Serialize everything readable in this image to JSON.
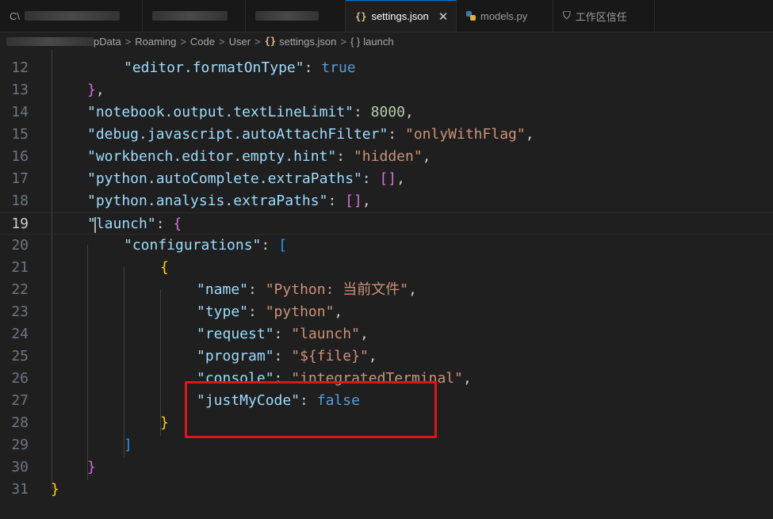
{
  "tabs": [
    {
      "label": "C\\",
      "blurred": true
    },
    {
      "label": "",
      "blurred": true
    },
    {
      "label": "",
      "blurred": true
    },
    {
      "label": "settings.json",
      "active": true,
      "icon": "curly-braces-icon"
    },
    {
      "label": "models.py",
      "icon": "python-icon"
    },
    {
      "label": "工作区信任",
      "icon": "shield-icon"
    }
  ],
  "close_glyph": "✕",
  "breadcrumb": {
    "separator": ">",
    "items": [
      "pData",
      "Roaming",
      "Code",
      "User",
      "settings.json",
      "launch"
    ],
    "json_icon": "{}",
    "object_icon": "{ }"
  },
  "editor": {
    "current_line": 19,
    "lines": [
      {
        "n": "12",
        "tokens": [
          [
            "k",
            "\"editor.formatOnType\""
          ],
          [
            "p",
            ": "
          ],
          [
            "b",
            "true"
          ]
        ]
      },
      {
        "n": "13",
        "tokens": [
          [
            "br2",
            "}"
          ],
          [
            "p",
            ","
          ]
        ]
      },
      {
        "n": "14",
        "tokens": [
          [
            "k",
            "\"notebook.output.textLineLimit\""
          ],
          [
            "p",
            ": "
          ],
          [
            "n",
            "8000"
          ],
          [
            "p",
            ","
          ]
        ]
      },
      {
        "n": "15",
        "tokens": [
          [
            "k",
            "\"debug.javascript.autoAttachFilter\""
          ],
          [
            "p",
            ": "
          ],
          [
            "s",
            "\"onlyWithFlag\""
          ],
          [
            "p",
            ","
          ]
        ]
      },
      {
        "n": "16",
        "tokens": [
          [
            "k",
            "\"workbench.editor.empty.hint\""
          ],
          [
            "p",
            ": "
          ],
          [
            "s",
            "\"hidden\""
          ],
          [
            "p",
            ","
          ]
        ]
      },
      {
        "n": "17",
        "tokens": [
          [
            "k",
            "\"python.autoComplete.extraPaths\""
          ],
          [
            "p",
            ": "
          ],
          [
            "br2",
            "[]"
          ],
          [
            "p",
            ","
          ]
        ]
      },
      {
        "n": "18",
        "tokens": [
          [
            "k",
            "\"python.analysis.extraPaths\""
          ],
          [
            "p",
            ": "
          ],
          [
            "br2",
            "[]"
          ],
          [
            "p",
            ","
          ]
        ]
      },
      {
        "n": "19",
        "tokens": [
          [
            "k",
            "\"launch\""
          ],
          [
            "p",
            ": "
          ],
          [
            "br2",
            "{"
          ]
        ]
      },
      {
        "n": "20",
        "tokens": [
          [
            "k",
            "\"configurations\""
          ],
          [
            "p",
            ": "
          ],
          [
            "br3",
            "["
          ]
        ]
      },
      {
        "n": "21",
        "tokens": [
          [
            "br1",
            "{"
          ]
        ]
      },
      {
        "n": "22",
        "tokens": [
          [
            "k",
            "\"name\""
          ],
          [
            "p",
            ": "
          ],
          [
            "s",
            "\"Python: 当前文件\""
          ],
          [
            "p",
            ","
          ]
        ]
      },
      {
        "n": "23",
        "tokens": [
          [
            "k",
            "\"type\""
          ],
          [
            "p",
            ": "
          ],
          [
            "s",
            "\"python\""
          ],
          [
            "p",
            ","
          ]
        ]
      },
      {
        "n": "24",
        "tokens": [
          [
            "k",
            "\"request\""
          ],
          [
            "p",
            ": "
          ],
          [
            "s",
            "\"launch\""
          ],
          [
            "p",
            ","
          ]
        ]
      },
      {
        "n": "25",
        "tokens": [
          [
            "k",
            "\"program\""
          ],
          [
            "p",
            ": "
          ],
          [
            "s",
            "\"${file}\""
          ],
          [
            "p",
            ","
          ]
        ]
      },
      {
        "n": "26",
        "tokens": [
          [
            "k",
            "\"console\""
          ],
          [
            "p",
            ": "
          ],
          [
            "s",
            "\"integratedTerminal\""
          ],
          [
            "p",
            ","
          ]
        ]
      },
      {
        "n": "27",
        "tokens": [
          [
            "k",
            "\"justMyCode\""
          ],
          [
            "p",
            ": "
          ],
          [
            "b",
            "false"
          ]
        ]
      },
      {
        "n": "28",
        "tokens": [
          [
            "br1",
            "}"
          ]
        ]
      },
      {
        "n": "29",
        "tokens": [
          [
            "br3",
            "]"
          ]
        ]
      },
      {
        "n": "30",
        "tokens": [
          [
            "br2",
            "}"
          ]
        ]
      },
      {
        "n": "31",
        "tokens": [
          [
            "br1",
            "}"
          ]
        ]
      }
    ]
  },
  "colors": {
    "annotation": "#e0141a",
    "key": "#9cdcfe",
    "string": "#ce9178",
    "keyword": "#569cd6"
  }
}
